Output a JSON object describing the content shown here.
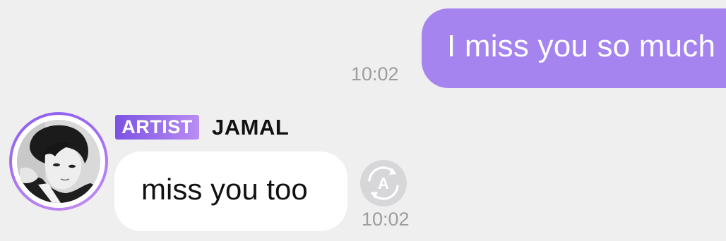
{
  "outgoing_message": {
    "text": "I miss you so much",
    "time": "10:02",
    "bubble_color": "#a584f0"
  },
  "incoming_message": {
    "sender_badge": "ARTIST",
    "sender_name": "JAMAL",
    "text": "miss you too",
    "time": "10:02",
    "translate_icon_label": "A",
    "translate_icon": "translate-icon"
  },
  "colors": {
    "background": "#efeff0",
    "badge_gradient_start": "#7b52e3",
    "badge_gradient_end": "#b98df2",
    "timestamp": "#9d9d9f"
  }
}
